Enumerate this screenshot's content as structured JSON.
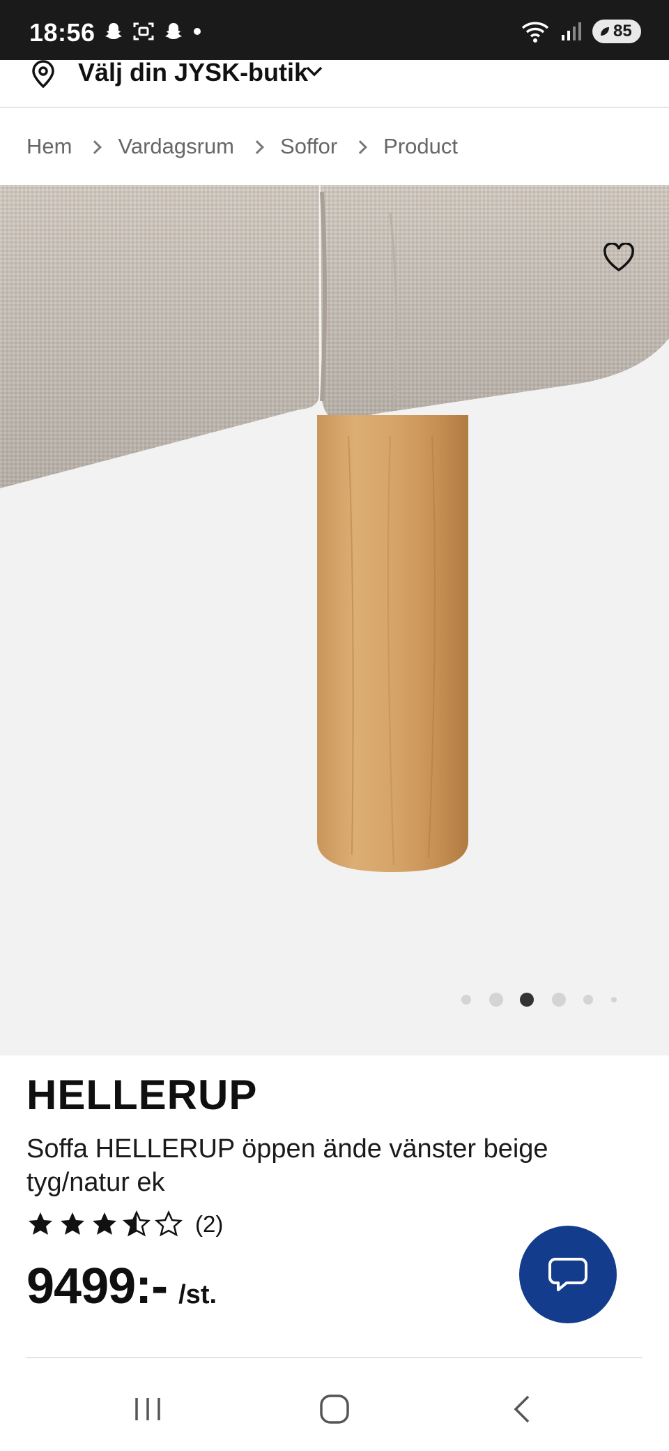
{
  "status_bar": {
    "time": "18:56",
    "battery": "85",
    "left_icons": [
      "snapchat-icon",
      "screenshot-icon",
      "snapchat-icon",
      "dot-icon"
    ],
    "right_icons": [
      "wifi-icon",
      "signal-icon",
      "battery-icon"
    ]
  },
  "store": {
    "label": "Välj din JYSK-butik"
  },
  "breadcrumb": [
    "Hem",
    "Vardagsrum",
    "Soffor",
    "Product"
  ],
  "gallery": {
    "slide_count": 6,
    "active_index": 2
  },
  "product": {
    "brand": "HELLERUP",
    "description": "Soffa HELLERUP öppen ände vänster beige tyg/natur ek",
    "rating": 3.5,
    "rating_max": 5,
    "review_count": "(2)",
    "price": "9499:-",
    "unit": "/st."
  },
  "colors": {
    "chat_button": "#143c8c",
    "gallery_bg": "#f3f2f2",
    "status_bar": "#1a1a1a"
  }
}
